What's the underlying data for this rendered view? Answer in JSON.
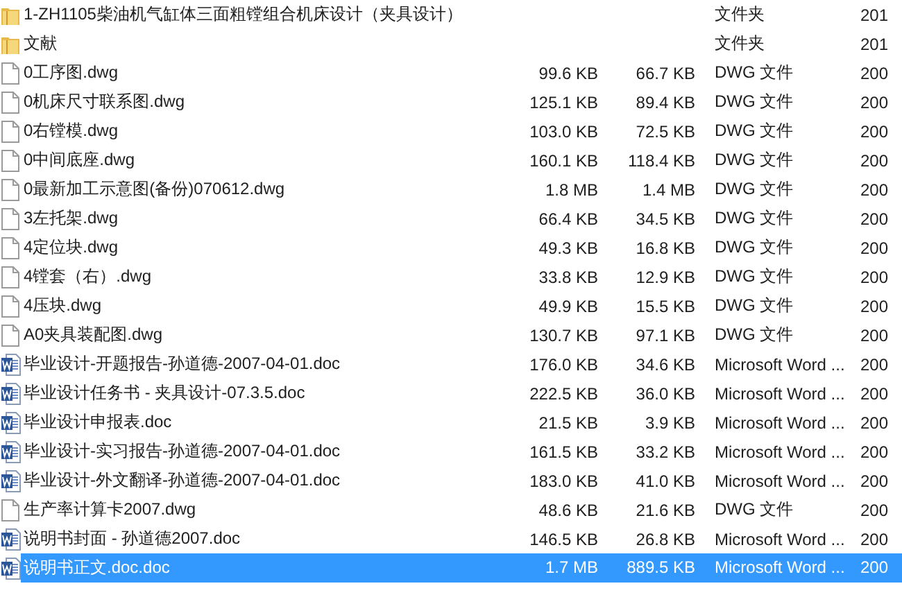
{
  "files": [
    {
      "kind": "folder",
      "name": "1-ZH1105柴油机气缸体三面粗镗组合机床设计（夹具设计）",
      "type": "文件夹",
      "date": "201",
      "selected": false
    },
    {
      "kind": "folder",
      "name": "文献",
      "type": "文件夹",
      "date": "201",
      "selected": false
    },
    {
      "kind": "file",
      "name": "0工序图.dwg",
      "size": "99.6 KB",
      "packed": "66.7 KB",
      "type": "DWG 文件",
      "date": "200",
      "selected": false
    },
    {
      "kind": "file",
      "name": "0机床尺寸联系图.dwg",
      "size": "125.1 KB",
      "packed": "89.4 KB",
      "type": "DWG 文件",
      "date": "200",
      "selected": false
    },
    {
      "kind": "file",
      "name": "0右镗模.dwg",
      "size": "103.0 KB",
      "packed": "72.5 KB",
      "type": "DWG 文件",
      "date": "200",
      "selected": false
    },
    {
      "kind": "file",
      "name": "0中间底座.dwg",
      "size": "160.1 KB",
      "packed": "118.4 KB",
      "type": "DWG 文件",
      "date": "200",
      "selected": false
    },
    {
      "kind": "file",
      "name": "0最新加工示意图(备份)070612.dwg",
      "size": "1.8 MB",
      "packed": "1.4 MB",
      "type": "DWG 文件",
      "date": "200",
      "selected": false
    },
    {
      "kind": "file",
      "name": "3左托架.dwg",
      "size": "66.4 KB",
      "packed": "34.5 KB",
      "type": "DWG 文件",
      "date": "200",
      "selected": false
    },
    {
      "kind": "file",
      "name": "4定位块.dwg",
      "size": "49.3 KB",
      "packed": "16.8 KB",
      "type": "DWG 文件",
      "date": "200",
      "selected": false
    },
    {
      "kind": "file",
      "name": "4镗套（右）.dwg",
      "size": "33.8 KB",
      "packed": "12.9 KB",
      "type": "DWG 文件",
      "date": "200",
      "selected": false
    },
    {
      "kind": "file",
      "name": "4压块.dwg",
      "size": "49.9 KB",
      "packed": "15.5 KB",
      "type": "DWG 文件",
      "date": "200",
      "selected": false
    },
    {
      "kind": "file",
      "name": "A0夹具装配图.dwg",
      "size": "130.7 KB",
      "packed": "97.1 KB",
      "type": "DWG 文件",
      "date": "200",
      "selected": false
    },
    {
      "kind": "word",
      "name": "毕业设计-开题报告-孙道德-2007-04-01.doc",
      "size": "176.0 KB",
      "packed": "34.6 KB",
      "type": "Microsoft Word ...",
      "date": "200",
      "selected": false
    },
    {
      "kind": "word",
      "name": "毕业设计任务书 - 夹具设计-07.3.5.doc",
      "size": "222.5 KB",
      "packed": "36.0 KB",
      "type": "Microsoft Word ...",
      "date": "200",
      "selected": false
    },
    {
      "kind": "word",
      "name": "毕业设计申报表.doc",
      "size": "21.5 KB",
      "packed": "3.9 KB",
      "type": "Microsoft Word ...",
      "date": "200",
      "selected": false
    },
    {
      "kind": "word",
      "name": "毕业设计-实习报告-孙道德-2007-04-01.doc",
      "size": "161.5 KB",
      "packed": "33.2 KB",
      "type": "Microsoft Word ...",
      "date": "200",
      "selected": false
    },
    {
      "kind": "word",
      "name": "毕业设计-外文翻译-孙道德-2007-04-01.doc",
      "size": "183.0 KB",
      "packed": "41.0 KB",
      "type": "Microsoft Word ...",
      "date": "200",
      "selected": false
    },
    {
      "kind": "file",
      "name": "生产率计算卡2007.dwg",
      "size": "48.6 KB",
      "packed": "21.6 KB",
      "type": "DWG 文件",
      "date": "200",
      "selected": false
    },
    {
      "kind": "word",
      "name": "说明书封面 - 孙道德2007.doc",
      "size": "146.5 KB",
      "packed": "26.8 KB",
      "type": "Microsoft Word ...",
      "date": "200",
      "selected": false
    },
    {
      "kind": "word",
      "name": "说明书正文.doc.doc",
      "size": "1.7 MB",
      "packed": "889.5 KB",
      "type": "Microsoft Word ...",
      "date": "200",
      "selected": true
    }
  ]
}
